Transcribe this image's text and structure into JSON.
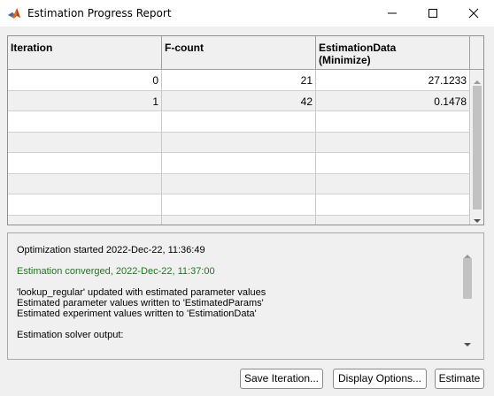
{
  "window": {
    "title": "Estimation Progress Report"
  },
  "table": {
    "headers": [
      {
        "line1": "Iteration",
        "line2": ""
      },
      {
        "line1": "F-count",
        "line2": ""
      },
      {
        "line1": "EstimationData",
        "line2": "(Minimize)"
      }
    ],
    "rows": [
      [
        "0",
        "21",
        "27.1233"
      ],
      [
        "1",
        "42",
        "0.1478"
      ],
      [
        "",
        "",
        ""
      ],
      [
        "",
        "",
        ""
      ],
      [
        "",
        "",
        ""
      ],
      [
        "",
        "",
        ""
      ],
      [
        "",
        "",
        ""
      ],
      [
        "",
        "",
        ""
      ]
    ]
  },
  "log": {
    "lines": [
      {
        "text": "Optimization started 2022-Dec-22, 11:36:49",
        "color": "#000000"
      },
      {
        "text": "Estimation converged, 2022-Dec-22, 11:37:00",
        "color": "#1a7a1a"
      },
      {
        "text": "'lookup_regular' updated with estimated parameter values",
        "color": "#000000"
      },
      {
        "text": "Estimated parameter values written to 'EstimatedParams'",
        "color": "#000000"
      },
      {
        "text": "Estimated experiment values written to 'EstimationData'",
        "color": "#000000"
      },
      {
        "text": "Estimation solver output:",
        "color": "#000000"
      }
    ]
  },
  "buttons": {
    "save_iteration": "Save Iteration...",
    "display_options": "Display Options...",
    "estimate": "Estimate"
  },
  "icons": {
    "app": "matlab-icon",
    "minimize": "minimize-icon",
    "maximize": "maximize-icon",
    "close": "close-icon"
  }
}
